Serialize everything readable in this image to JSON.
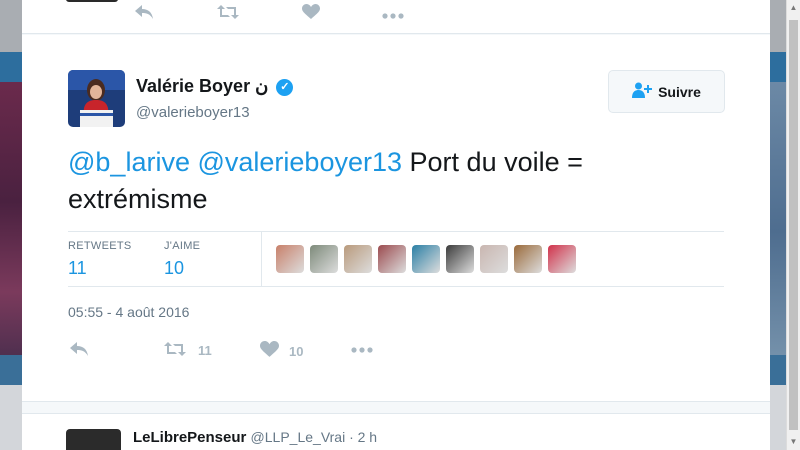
{
  "tweet": {
    "author_name": "Valérie Boyer",
    "author_name_suffix": "ن",
    "handle": "@valerieboyer13",
    "follow_label": "Suivre",
    "text_mention_1": "@b_larive",
    "text_mention_2": "@valerieboyer13",
    "text_body": "Port du voile = extrémisme",
    "retweets_label": "RETWEETS",
    "retweets_count": "11",
    "likes_label": "J'AIME",
    "likes_count": "10",
    "timestamp": "05:55 - 4 août 2016",
    "action_retweet_count": "11",
    "action_like_count": "10",
    "likers": [
      {
        "icon": "liker-avatar",
        "color": "#c8806a"
      },
      {
        "icon": "liker-avatar",
        "color": "#7d8a7a"
      },
      {
        "icon": "liker-avatar",
        "color": "#b99a7c"
      },
      {
        "icon": "liker-avatar",
        "color": "#9b4a4e"
      },
      {
        "icon": "liker-avatar",
        "color": "#2a7fa5"
      },
      {
        "icon": "liker-avatar",
        "color": "#3b3b3b"
      },
      {
        "icon": "liker-avatar",
        "color": "#c9b6b0"
      },
      {
        "icon": "liker-avatar",
        "color": "#9a6a3a"
      },
      {
        "icon": "liker-avatar",
        "color": "#d1314a"
      }
    ]
  },
  "next_tweet": {
    "name": "LeLibrePenseur",
    "handle_time": "@LLP_Le_Vrai · 2 h"
  },
  "colors": {
    "link": "#1b95e0",
    "verified": "#1da1f2",
    "muted": "#657786",
    "action_icon": "#aab8c2"
  },
  "icons": [
    "reply-icon",
    "retweet-icon",
    "heart-icon",
    "more-icon",
    "verified-icon",
    "follow-user-icon"
  ]
}
